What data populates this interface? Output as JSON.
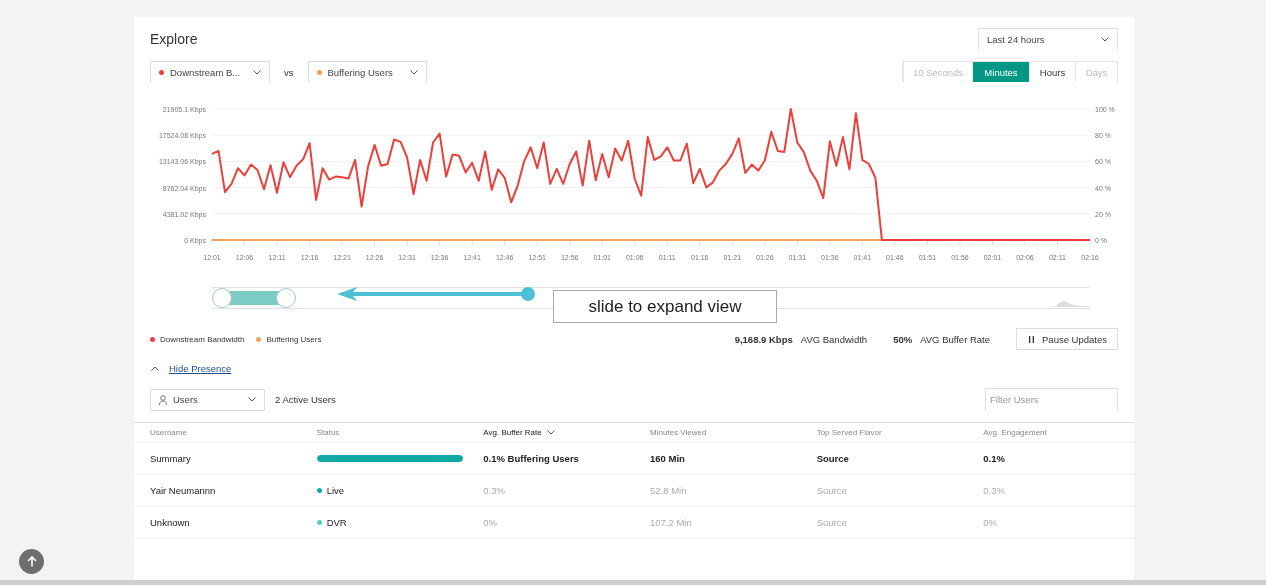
{
  "header": {
    "title": "Explore",
    "range_select": {
      "value": "Last 24 hours"
    }
  },
  "metrics": [
    {
      "label": "Downstream B...",
      "color": "#e8413c"
    },
    {
      "label": "Buffering Users",
      "color": "#f0a04b"
    }
  ],
  "compare_label": "vs",
  "granularity": [
    {
      "label": "10 Seconds",
      "selected": false,
      "disabled": true
    },
    {
      "label": "Minutes",
      "selected": true,
      "disabled": false
    },
    {
      "label": "Hours",
      "selected": false,
      "disabled": false
    },
    {
      "label": "Days",
      "selected": false,
      "disabled": true
    }
  ],
  "chart": {
    "chart_data": {
      "type": "line",
      "categories": [
        "12:01",
        null,
        null,
        null,
        null,
        "12:06",
        null,
        null,
        null,
        null,
        "12:11",
        null,
        null,
        null,
        null,
        "12:16",
        null,
        null,
        null,
        null,
        "12:21",
        null,
        null,
        null,
        null,
        "12:26",
        null,
        null,
        null,
        null,
        "12:31",
        null,
        null,
        null,
        null,
        "12:36",
        null,
        null,
        null,
        null,
        "12:41",
        null,
        null,
        null,
        null,
        "12:46",
        null,
        null,
        null,
        null,
        "12:51",
        null,
        null,
        null,
        null,
        "12:56",
        null,
        null,
        null,
        null,
        "01:01",
        null,
        null,
        null,
        null,
        "01:06",
        null,
        null,
        null,
        null,
        "01:11",
        null,
        null,
        null,
        null,
        "01:16",
        null,
        null,
        null,
        null,
        "01:21",
        null,
        null,
        null,
        null,
        "01:26",
        null,
        null,
        null,
        null,
        "01:31",
        null,
        null,
        null,
        null,
        "01:36",
        null,
        null,
        null,
        null,
        "01:41",
        null,
        null,
        null,
        null,
        "01:46",
        null,
        null,
        null,
        null,
        "01:51",
        null,
        null,
        null,
        null,
        "01:56",
        null,
        null,
        null,
        null,
        "02:01",
        null,
        null,
        null,
        null,
        "02:06",
        null,
        null,
        null,
        null,
        "02:11",
        null,
        null,
        null,
        null,
        "02:16"
      ],
      "series": [
        {
          "name": "Downstream Bandwidth",
          "color": "#e8413c",
          "values": [
            14400,
            14900,
            8000,
            9400,
            12000,
            10800,
            12600,
            11700,
            8500,
            12500,
            7900,
            13000,
            10500,
            12400,
            13500,
            16200,
            6700,
            12000,
            10100,
            10600,
            10500,
            10300,
            13400,
            5600,
            12300,
            15900,
            12400,
            12700,
            16800,
            16400,
            13800,
            7700,
            13400,
            9900,
            16300,
            17800,
            10600,
            14300,
            14100,
            11300,
            12900,
            9900,
            14800,
            8400,
            11800,
            10400,
            6300,
            9100,
            13200,
            15500,
            12000,
            16300,
            9400,
            11900,
            9400,
            12700,
            14800,
            9100,
            16600,
            10000,
            14400,
            10500,
            15300,
            13300,
            16600,
            10200,
            7400,
            17200,
            13400,
            14000,
            15500,
            13300,
            13300,
            16100,
            9500,
            11900,
            8800,
            9600,
            11600,
            12700,
            14400,
            17000,
            11200,
            12600,
            11600,
            13300,
            18100,
            14900,
            14700,
            21900,
            16300,
            14700,
            11600,
            9900,
            7000,
            16500,
            12400,
            17200,
            11800,
            21200,
            13400,
            12700,
            10400,
            0,
            0,
            0,
            0,
            0,
            0,
            0,
            0,
            0,
            0,
            0,
            0,
            0,
            0,
            0,
            0,
            0,
            0,
            0,
            0,
            0,
            0,
            0,
            0,
            0,
            0,
            0,
            0,
            0,
            0,
            0,
            0,
            0
          ]
        },
        {
          "name": "Buffering Users",
          "color": "#f4a259",
          "values": [
            0,
            0,
            0,
            0,
            0,
            0,
            0,
            0,
            0,
            0,
            0,
            0,
            0,
            0,
            0,
            0,
            0,
            0,
            0,
            0,
            0,
            0,
            0,
            0,
            0,
            0,
            0,
            0,
            0,
            0,
            0,
            0,
            0,
            0,
            0,
            0,
            0,
            0,
            0,
            0,
            0,
            0,
            0,
            0,
            0,
            0,
            0,
            0,
            0,
            0,
            0,
            0,
            0,
            0,
            0,
            0,
            0,
            0,
            0,
            0,
            0,
            0,
            0,
            0,
            0,
            0,
            0,
            0,
            0,
            0,
            0,
            0,
            0,
            0,
            0,
            0,
            0,
            0,
            0,
            0,
            0,
            0,
            0,
            0,
            0,
            0,
            0,
            0,
            0,
            0,
            0,
            0,
            0,
            0,
            0,
            0,
            0,
            0,
            0,
            0,
            0,
            0,
            0,
            0,
            0,
            0,
            null,
            null,
            null,
            null,
            null,
            null,
            null,
            null,
            null,
            null,
            null,
            null,
            null,
            null,
            null,
            null,
            null,
            null,
            null,
            null,
            null,
            null,
            null,
            null,
            null,
            null,
            null,
            null,
            null,
            null
          ]
        }
      ],
      "ylim": [
        0,
        21905.1
      ],
      "y2lim": [
        0,
        1
      ],
      "grid": true,
      "yticks": [
        {
          "value": 0,
          "label": "0 Kbps"
        },
        {
          "value": 4381.02,
          "label": "4381.02 Kbps"
        },
        {
          "value": 8762.04,
          "label": "8762.04 Kbps"
        },
        {
          "value": 13143.06,
          "label": "13143.06 Kbps"
        },
        {
          "value": 17524.08,
          "label": "17524.08 Kbps"
        },
        {
          "value": 21905.1,
          "label": "21905.1 Kbps"
        }
      ],
      "y2ticks": [
        {
          "value": 0,
          "label": "0 %"
        },
        {
          "value": 0.2,
          "label": "20 %"
        },
        {
          "value": 0.4,
          "label": "40 %"
        },
        {
          "value": 0.6,
          "label": "60 %"
        },
        {
          "value": 0.8,
          "label": "80 %"
        },
        {
          "value": 1,
          "label": "100 %"
        }
      ]
    }
  },
  "hint": {
    "text": "slide to expand view"
  },
  "stats": [
    {
      "value": "9,168.9 Kbps",
      "label": "AVG Bandwidth"
    },
    {
      "value": "50%",
      "label": "AVG Buffer Rate"
    }
  ],
  "pause_button": {
    "label": "Pause Updates"
  },
  "presence_toggle": {
    "label": "Hide Presence",
    "expanded": true
  },
  "users_select": {
    "value": "Users"
  },
  "active_users": "2 Active Users",
  "filter": {
    "placeholder": "Filter Users"
  },
  "table": {
    "columns": [
      {
        "label": "Username",
        "sorted": false
      },
      {
        "label": "Status",
        "sorted": false
      },
      {
        "label": "Avg. Buffer Rate",
        "sorted": true
      },
      {
        "label": "Minutes Viewed",
        "sorted": false
      },
      {
        "label": "Top Served Flavor",
        "sorted": false
      },
      {
        "label": "Avg. Engagement",
        "sorted": false
      }
    ],
    "rows": [
      {
        "kind": "summary",
        "cells": [
          "Summary",
          {
            "kind": "bar",
            "level": 1
          },
          "0.1% Buffering Users",
          "160 Min",
          "Source",
          "0.1%"
        ]
      },
      {
        "kind": "user",
        "cells": [
          "Yair Neumannn",
          {
            "kind": "dot",
            "label": "Live",
            "color": "#11a8a5"
          },
          "0.3%",
          "52.8 Min",
          "Source",
          "0.3%"
        ]
      },
      {
        "kind": "user",
        "cells": [
          "Unknown",
          {
            "kind": "dot",
            "label": "DVR",
            "color": "#4fcfd0"
          },
          "0%",
          "107.2 Min",
          "Source",
          "0%"
        ]
      }
    ]
  }
}
